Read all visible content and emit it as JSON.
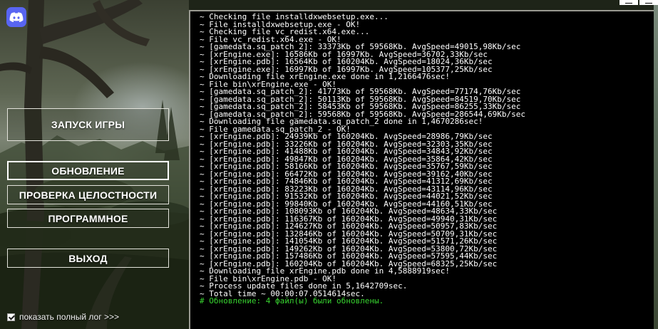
{
  "app": {
    "discord_icon": "discord-icon",
    "accent": "#5865f2"
  },
  "menu": {
    "launch": "ЗАПУСК ИГРЫ",
    "update": "ОБНОВЛЕНИЕ",
    "check": "ПРОВЕРКА ЦЕЛОСТНОСТИ",
    "program": "ПРОГРАММНОЕ",
    "exit": "ВЫХОД"
  },
  "log_toggle": {
    "label": "показать полный лог >>>",
    "checked": true
  },
  "terminal": {
    "lines": [
      "~ Checking file installdxwebsetup.exe...",
      "~ File installdxwebsetup.exe - OK!",
      "~ Checking file vc_redist.x64.exe...",
      "~ File vc_redist.x64.exe - OK!",
      "~ [gamedata.sq_patch_2]: 33373Kb of 59568Kb. AvgSpeed=49015,98Kb/sec",
      "~ [xrEngine.exe]: 16586Kb of 16997Kb. AvgSpeed=36702,33Kb/sec",
      "~ [xrEngine.pdb]: 16564Kb of 160204Kb. AvgSpeed=18024,36Kb/sec",
      "~ [xrEngine.exe]: 16997Kb of 16997Kb. AvgSpeed=105377,25Kb/sec",
      "~ Downloading file xrEngine.exe done in 1,2166476sec!",
      "~ File bin\\xrEngine.exe - OK!",
      "~ [gamedata.sq_patch_2]: 41773Kb of 59568Kb. AvgSpeed=77174,76Kb/sec",
      "~ [gamedata.sq_patch_2]: 50113Kb of 59568Kb. AvgSpeed=84519,70Kb/sec",
      "~ [gamedata.sq_patch_2]: 58453Kb of 59568Kb. AvgSpeed=86255,33Kb/sec",
      "~ [gamedata.sq_patch_2]: 59568Kb of 59568Kb. AvgSpeed=286544,69Kb/sec",
      "~ Downloading file gamedata.sq_patch_2 done in 1,4670286sec!",
      "~ File gamedata.sq_patch_2 - OK!",
      "~ [xrEngine.pdb]: 24939Kb of 160204Kb. AvgSpeed=28986,79Kb/sec",
      "~ [xrEngine.pdb]: 33226Kb of 160204Kb. AvgSpeed=32303,35Kb/sec",
      "~ [xrEngine.pdb]: 41488Kb of 160204Kb. AvgSpeed=34843,92Kb/sec",
      "~ [xrEngine.pdb]: 49847Kb of 160204Kb. AvgSpeed=35864,42Kb/sec",
      "~ [xrEngine.pdb]: 58166Kb of 160204Kb. AvgSpeed=35767,59Kb/sec",
      "~ [xrEngine.pdb]: 66472Kb of 160204Kb. AvgSpeed=39162,40Kb/sec",
      "~ [xrEngine.pdb]: 74846Kb of 160204Kb. AvgSpeed=41312,69Kb/sec",
      "~ [xrEngine.pdb]: 83223Kb of 160204Kb. AvgSpeed=43114,96Kb/sec",
      "~ [xrEngine.pdb]: 91532Kb of 160204Kb. AvgSpeed=44021,52Kb/sec",
      "~ [xrEngine.pdb]: 99840Kb of 160204Kb. AvgSpeed=44160,51Kb/sec",
      "~ [xrEngine.pdb]: 108093Kb of 160204Kb. AvgSpeed=48634,33Kb/sec",
      "~ [xrEngine.pdb]: 116367Kb of 160204Kb. AvgSpeed=49940,31Kb/sec",
      "~ [xrEngine.pdb]: 124627Kb of 160204Kb. AvgSpeed=50957,83Kb/sec",
      "~ [xrEngine.pdb]: 132846Kb of 160204Kb. AvgSpeed=50709,31Kb/sec",
      "~ [xrEngine.pdb]: 141054Kb of 160204Kb. AvgSpeed=51571,26Kb/sec",
      "~ [xrEngine.pdb]: 149262Kb of 160204Kb. AvgSpeed=53800,72Kb/sec",
      "~ [xrEngine.pdb]: 157486Kb of 160204Kb. AvgSpeed=57595,44Kb/sec",
      "~ [xrEngine.pdb]: 160204Kb of 160204Kb. AvgSpeed=68325,25Kb/sec",
      "~ Downloading file xrEngine.pdb done in 4,5888919sec!",
      "~ File bin\\xrEngine.pdb - OK!",
      "~ Process update files done in 5,1642709sec.",
      "~ Total time ~ 00:00:07.0514614sec."
    ],
    "final_line": "# Обновление: 4 файл(ы) были обновлены.",
    "text_color": "#ffffff",
    "success_color": "#38d430"
  },
  "window_controls": {
    "minimize": "minimize-icon",
    "close": "close-icon"
  }
}
